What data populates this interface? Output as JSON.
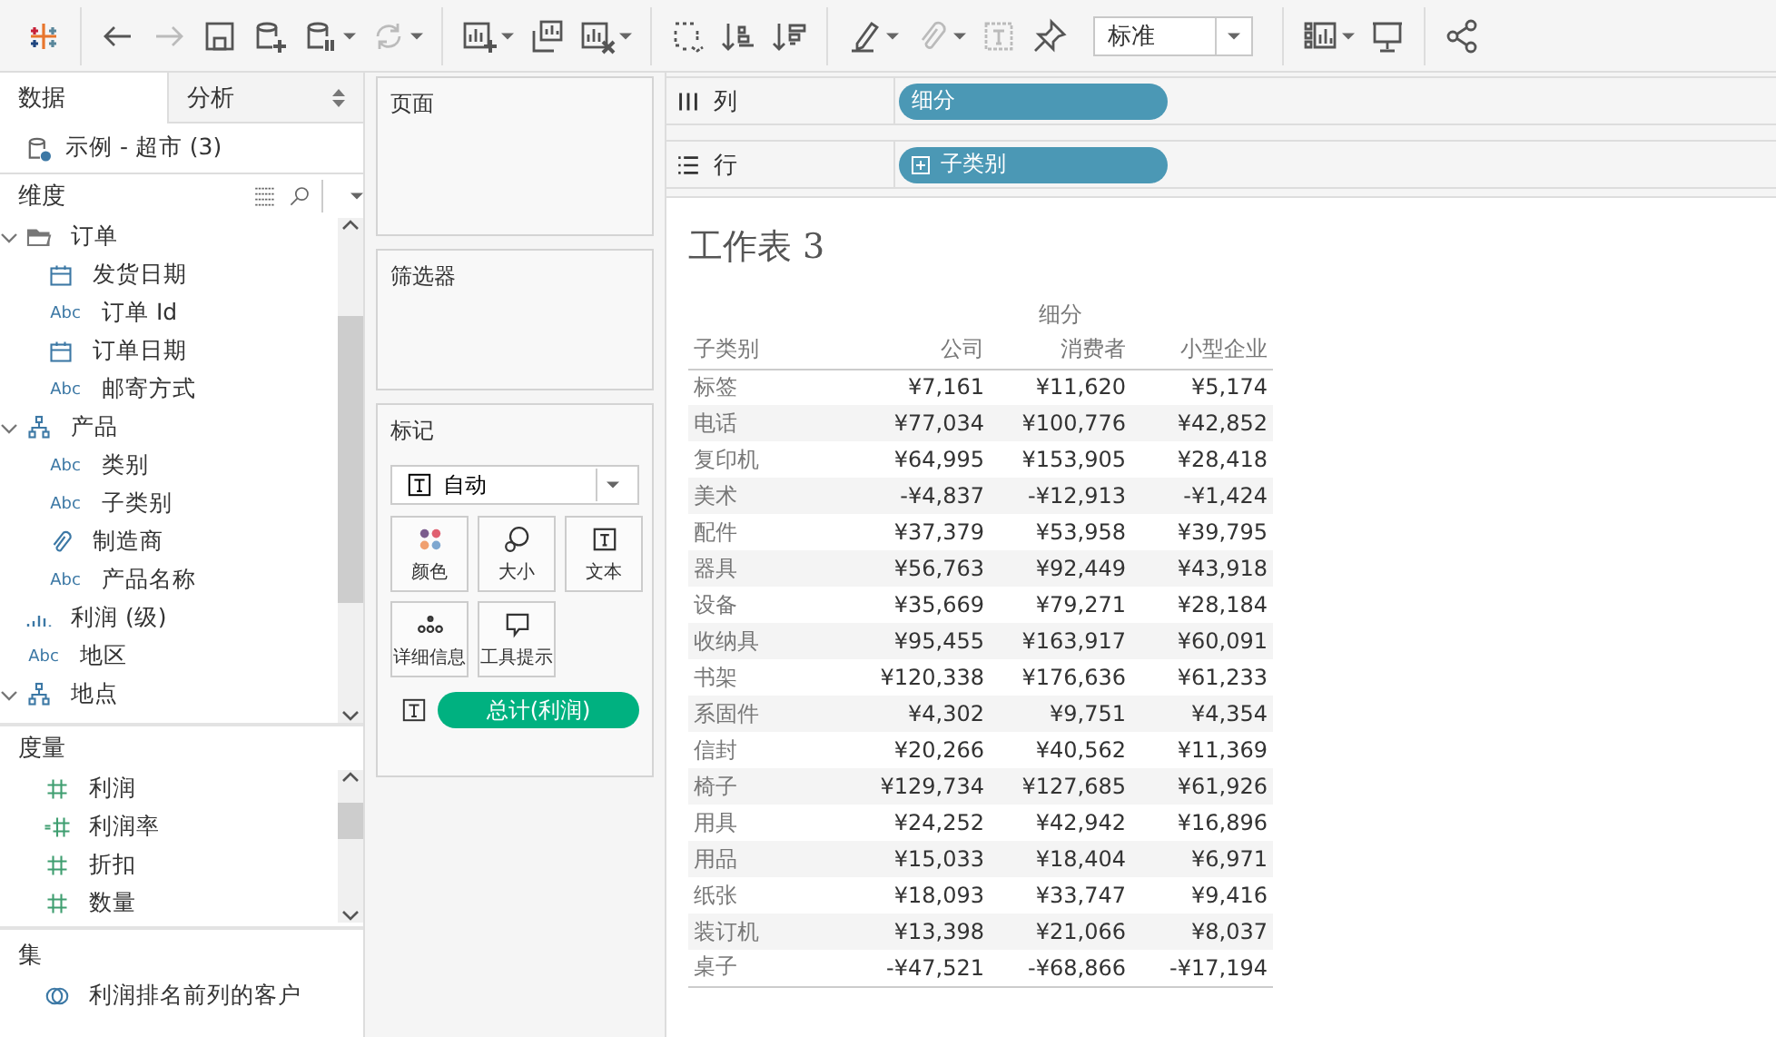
{
  "toolbar": {
    "groups": [
      [
        {
          "disabled": false,
          "menu": false
        }
      ],
      [
        {
          "disabled": false,
          "menu": false
        },
        {
          "disabled": true,
          "menu": false
        },
        {
          "disabled": false,
          "menu": false
        },
        {
          "disabled": false,
          "menu": false
        },
        {
          "disabled": false,
          "menu": true
        },
        {
          "disabled": true,
          "menu": true
        }
      ],
      [
        {
          "disabled": false,
          "menu": true
        },
        {
          "disabled": false,
          "menu": false
        },
        {
          "disabled": false,
          "menu": true
        }
      ],
      [
        {
          "disabled": false,
          "menu": false
        },
        {
          "disabled": false,
          "menu": false
        },
        {
          "disabled": false,
          "menu": false
        }
      ],
      [
        {
          "disabled": false,
          "menu": true
        },
        {
          "disabled": true,
          "menu": true
        },
        {
          "disabled": true,
          "menu": false
        },
        {
          "disabled": false,
          "menu": false
        }
      ]
    ],
    "fit_select": {
      "value": "标准"
    },
    "right_groups": [
      [
        {
          "disabled": false,
          "menu": true
        },
        {
          "disabled": false,
          "menu": false
        }
      ],
      [
        {
          "disabled": false,
          "menu": false
        }
      ]
    ]
  },
  "side_tabs": [
    {
      "label": "数据",
      "selected": true
    },
    {
      "label": "分析",
      "selected": false
    }
  ],
  "data_source": "示例 - 超市 (3)",
  "dimensions": {
    "title": "维度",
    "items": [
      {
        "label": "订单",
        "kind": "folder",
        "expanded": true,
        "children": [
          {
            "label": "发货日期",
            "kind": "date"
          },
          {
            "label": "订单 Id",
            "kind": "string",
            "type_label": "Abc"
          },
          {
            "label": "订单日期",
            "kind": "date"
          },
          {
            "label": "邮寄方式",
            "kind": "string",
            "type_label": "Abc"
          }
        ]
      },
      {
        "label": "产品",
        "kind": "hierarchy",
        "expanded": true,
        "children": [
          {
            "label": "类别",
            "kind": "string",
            "type_label": "Abc"
          },
          {
            "label": "子类别",
            "kind": "string",
            "type_label": "Abc"
          },
          {
            "label": "制造商",
            "kind": "group"
          },
          {
            "label": "产品名称",
            "kind": "string",
            "type_label": "Abc"
          }
        ]
      },
      {
        "label": "利润 (级)",
        "kind": "bin"
      },
      {
        "label": "地区",
        "kind": "string",
        "type_label": "Abc"
      },
      {
        "label": "地点",
        "kind": "hierarchy",
        "expanded": true
      }
    ]
  },
  "measures": {
    "title": "度量",
    "items": [
      {
        "label": "利润",
        "kind": "number"
      },
      {
        "label": "利润率",
        "kind": "calc"
      },
      {
        "label": "折扣",
        "kind": "number"
      },
      {
        "label": "数量",
        "kind": "number"
      }
    ]
  },
  "sets": {
    "title": "集",
    "items": [
      {
        "label": "利润排名前列的客户",
        "kind": "set"
      }
    ]
  },
  "pages_card": {
    "title": "页面"
  },
  "filters_card": {
    "title": "筛选器"
  },
  "marks_card": {
    "title": "标记",
    "mark_type": "自动",
    "buttons": [
      "颜色",
      "大小",
      "文本",
      "详细信息",
      "工具提示"
    ],
    "pills": [
      {
        "label": "总计(利润)"
      }
    ]
  },
  "shelves": [
    {
      "label": "列",
      "pills": [
        {
          "label": "细分",
          "expandable": false
        }
      ]
    },
    {
      "label": "行",
      "pills": [
        {
          "label": "子类别",
          "expandable": true
        }
      ]
    }
  ],
  "sheet": {
    "title": "工作表 3",
    "column_group": "细分",
    "row_header": "子类别",
    "columns": [
      "公司",
      "消费者",
      "小型企业"
    ],
    "rows": [
      {
        "label": "标签",
        "values": [
          "¥7,161",
          "¥11,620",
          "¥5,174"
        ]
      },
      {
        "label": "电话",
        "values": [
          "¥77,034",
          "¥100,776",
          "¥42,852"
        ]
      },
      {
        "label": "复印机",
        "values": [
          "¥64,995",
          "¥153,905",
          "¥28,418"
        ]
      },
      {
        "label": "美术",
        "values": [
          "-¥4,837",
          "-¥12,913",
          "-¥1,424"
        ]
      },
      {
        "label": "配件",
        "values": [
          "¥37,379",
          "¥53,958",
          "¥39,795"
        ]
      },
      {
        "label": "器具",
        "values": [
          "¥56,763",
          "¥92,449",
          "¥43,918"
        ]
      },
      {
        "label": "设备",
        "values": [
          "¥35,669",
          "¥79,271",
          "¥28,184"
        ]
      },
      {
        "label": "收纳具",
        "values": [
          "¥95,455",
          "¥163,917",
          "¥60,091"
        ]
      },
      {
        "label": "书架",
        "values": [
          "¥120,338",
          "¥176,636",
          "¥61,233"
        ]
      },
      {
        "label": "系固件",
        "values": [
          "¥4,302",
          "¥9,751",
          "¥4,354"
        ]
      },
      {
        "label": "信封",
        "values": [
          "¥20,266",
          "¥40,562",
          "¥11,369"
        ]
      },
      {
        "label": "椅子",
        "values": [
          "¥129,734",
          "¥127,685",
          "¥61,926"
        ]
      },
      {
        "label": "用具",
        "values": [
          "¥24,252",
          "¥42,942",
          "¥16,896"
        ]
      },
      {
        "label": "用品",
        "values": [
          "¥15,033",
          "¥18,404",
          "¥6,971"
        ]
      },
      {
        "label": "纸张",
        "values": [
          "¥18,093",
          "¥33,747",
          "¥9,416"
        ]
      },
      {
        "label": "装订机",
        "values": [
          "¥13,398",
          "¥21,066",
          "¥8,037"
        ]
      },
      {
        "label": "桌子",
        "values": [
          "-¥47,521",
          "-¥68,866",
          "-¥17,194"
        ]
      }
    ]
  }
}
